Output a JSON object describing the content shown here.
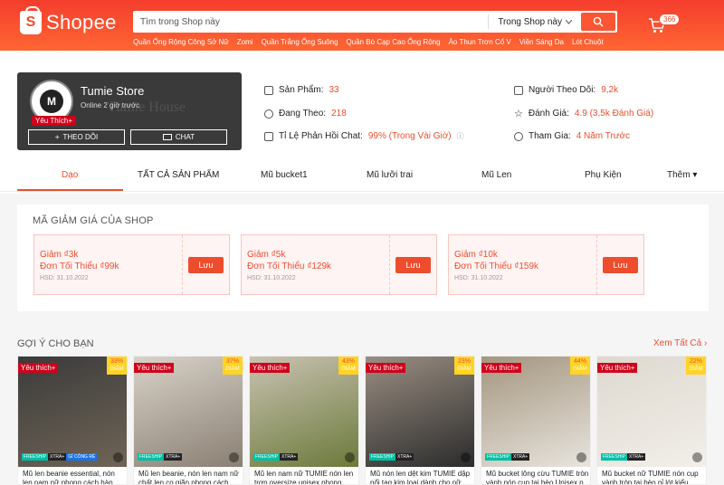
{
  "header": {
    "logo_text": "Shopee",
    "search_placeholder": "Tìm trong Shop này",
    "search_scope": "Trong Shop này",
    "hint_links": [
      "Quần Ống Rộng Công Sở Nữ",
      "Zomi",
      "Quần Trắng Ống Suông",
      "Quần Bò Cạp Cao Ống Rộng",
      "Áo Thun Trơn Cổ V",
      "Viền Sáng Da",
      "Lót Chuột"
    ],
    "cart_count": "366"
  },
  "shop": {
    "name": "Tumie Store",
    "online": "Online 2 giờ trước",
    "badge": "Yêu Thích+",
    "background_text": "Tumie House",
    "follow_label": "THEO DÕI",
    "chat_label": "CHAT",
    "stats": [
      {
        "label": "Sản Phẩm:",
        "value": "33"
      },
      {
        "label": "Đang Theo:",
        "value": "218"
      },
      {
        "label": "Tỉ Lệ Phản Hồi Chat:",
        "value": "99% (Trong Vài Giờ)"
      },
      {
        "label": "Người Theo Dõi:",
        "value": "9,2k"
      },
      {
        "label": "Đánh Giá:",
        "value": "4.9 (3,5k Đánh Giá)"
      },
      {
        "label": "Tham Gia:",
        "value": "4 Năm Trước"
      }
    ]
  },
  "tabs": [
    "Dạo",
    "TẤT CẢ SẢN PHẨM",
    "Mũ bucket1",
    "Mũ lưỡi trai",
    "Mũ Len",
    "Phụ Kiện",
    "Thêm ▾"
  ],
  "vouchers": {
    "title": "MÃ GIẢM GIÁ CỦA SHOP",
    "items": [
      {
        "discount": "Giảm ₫3k",
        "min": "Đơn Tối Thiểu ₫99k",
        "expiry": "HSD: 31.10.2022",
        "button": "Lưu"
      },
      {
        "discount": "Giảm ₫5k",
        "min": "Đơn Tối Thiểu ₫129k",
        "expiry": "HSD: 31.10.2022",
        "button": "Lưu"
      },
      {
        "discount": "Giảm ₫10k",
        "min": "Đơn Tối Thiểu ₫159k",
        "expiry": "HSD: 31.10.2022",
        "button": "Lưu"
      }
    ]
  },
  "recommend": {
    "title": "GỢI Ý CHO BẠN",
    "see_all": "Xem Tất Cả",
    "products": [
      {
        "name": "Mũ len beanie essential, nón len nam nữ phong cách hàn quốc",
        "discount": "33%",
        "fav": "Yêu thích+",
        "ship": "FREESHIP",
        "xtra": "XTRA+",
        "promo": "GỈ CÔNG RẺ"
      },
      {
        "name": "Mũ len beanie, nón len nam nữ chất len co giãn phong cách hàn",
        "discount": "37%",
        "fav": "Yêu thích+",
        "ship": "FREESHIP",
        "xtra": "XTRA+"
      },
      {
        "name": "Mũ len nam nữ TUMIE nón len trơn oversize unisex phong cách",
        "discount": "43%",
        "fav": "Yêu thích+",
        "ship": "FREESHIP",
        "xtra": "XTRA+"
      },
      {
        "name": "Mũ nón len dệt kim TUMIE dập nổi tag kim loại dành cho nữ",
        "discount": "23%",
        "fav": "Yêu thích+",
        "ship": "FREESHIP",
        "xtra": "XTRA+"
      },
      {
        "name": "Mũ bucket lông cừu TUMIE tròn vành nón cụp tai bèo Unisex p",
        "discount": "44%",
        "fav": "Yêu thích+",
        "ship": "FREESHIP",
        "xtra": "XTRA+"
      },
      {
        "name": "Mũ bucket nữ TUMIE nón cụp vành tròn tai bèo nỉ lót kiểu",
        "discount": "22%",
        "fav": "Yêu thích+",
        "ship": "FREESHIP",
        "xtra": "XTRA+"
      }
    ],
    "discount_word": "GIẢM"
  }
}
